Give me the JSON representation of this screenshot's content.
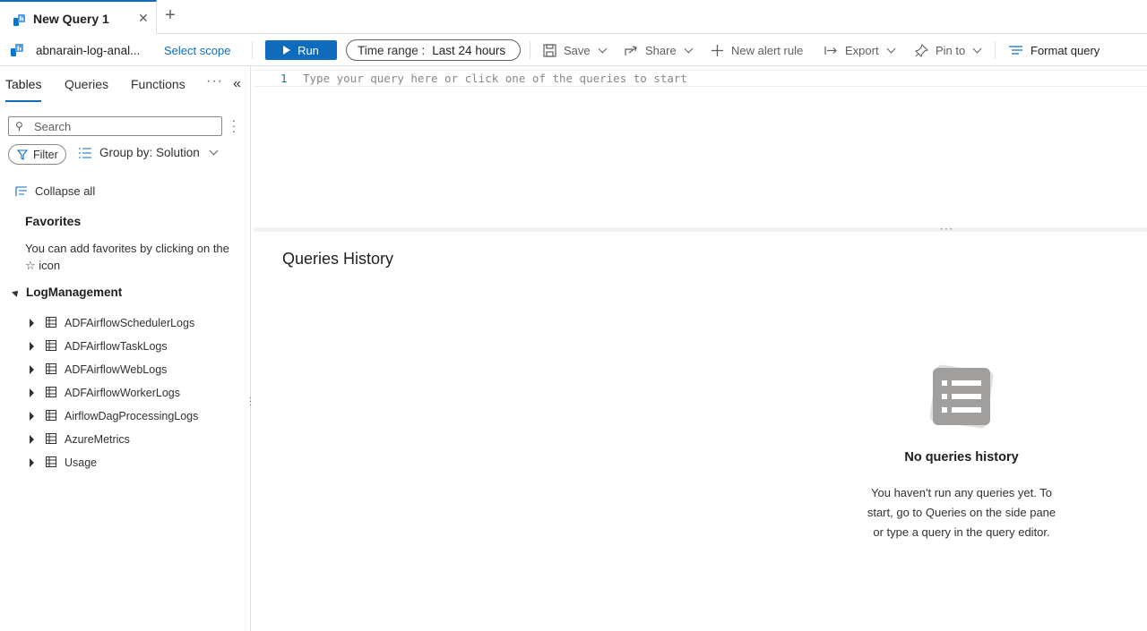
{
  "tabs": {
    "active_title": "New Query 1",
    "close_glyph": "✕",
    "new_tab_glyph": "+"
  },
  "toolbar": {
    "scope_name": "abnarain-log-anal...",
    "select_scope": "Select scope",
    "run_label": "Run",
    "time_range_label": "Time range :",
    "time_range_value": "Last 24 hours",
    "save_label": "Save",
    "share_label": "Share",
    "new_alert_label": "New alert rule",
    "export_label": "Export",
    "pin_label": "Pin to",
    "format_label": "Format query"
  },
  "sidebar": {
    "tabs": [
      "Tables",
      "Queries",
      "Functions"
    ],
    "more_glyph": "···",
    "collapse_glyph": "«",
    "search_placeholder": "Search",
    "filter_label": "Filter",
    "group_by_label": "Group by: Solution",
    "collapse_all_label": "Collapse all",
    "favorites_title": "Favorites",
    "favorites_text": "You can add favorites by clicking on the ☆ icon",
    "group_title": "LogManagement",
    "tables": [
      "ADFAirflowSchedulerLogs",
      "ADFAirflowTaskLogs",
      "ADFAirflowWebLogs",
      "ADFAirflowWorkerLogs",
      "AirflowDagProcessingLogs",
      "AzureMetrics",
      "Usage"
    ]
  },
  "editor": {
    "line_number": "1",
    "placeholder": "Type your query here or click one of the queries to start"
  },
  "results": {
    "title": "Queries History",
    "empty_title": "No queries history",
    "empty_text": "You haven't run any queries yet. To start, go to Queries on the side pane or type a query in the query editor."
  },
  "colors": {
    "accent": "#0f6cbd",
    "text": "#323130",
    "border": "#e1dfdd"
  }
}
